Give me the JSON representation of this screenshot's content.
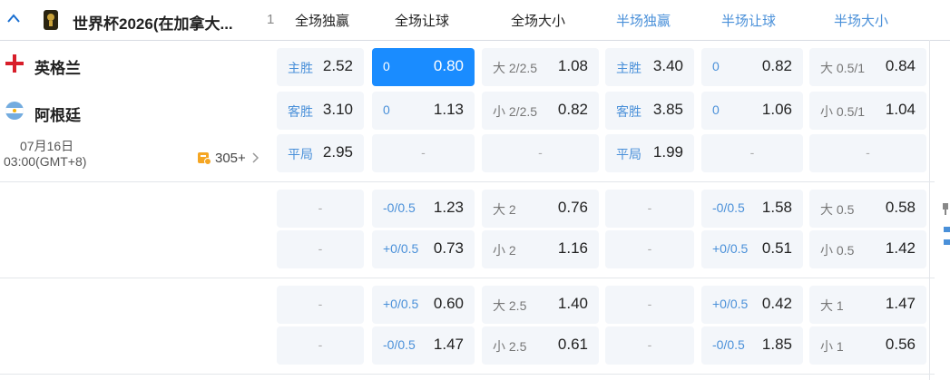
{
  "league": {
    "name": "世界杯2026(在加拿大...",
    "count": "1"
  },
  "columns": [
    "全场独赢",
    "全场让球",
    "全场大小",
    "半场独赢",
    "半场让球",
    "半场大小"
  ],
  "match": {
    "home": "英格兰",
    "away": "阿根廷",
    "date": "07月16日",
    "time": "03:00(GMT+8)",
    "more": "305+"
  },
  "rows": [
    {
      "fw": {
        "l": "主胜",
        "v": "2.52"
      },
      "fh": {
        "l": "0",
        "v": "0.80",
        "sel": true
      },
      "fo": {
        "l": "大 2/2.5",
        "v": "1.08"
      },
      "hw": {
        "l": "主胜",
        "v": "3.40"
      },
      "hh": {
        "l": "0",
        "v": "0.82"
      },
      "ho": {
        "l": "大 0.5/1",
        "v": "0.84"
      }
    },
    {
      "fw": {
        "l": "客胜",
        "v": "3.10"
      },
      "fh": {
        "l": "0",
        "v": "1.13"
      },
      "fo": {
        "l": "小 2/2.5",
        "v": "0.82"
      },
      "hw": {
        "l": "客胜",
        "v": "3.85"
      },
      "hh": {
        "l": "0",
        "v": "1.06"
      },
      "ho": {
        "l": "小 0.5/1",
        "v": "1.04"
      }
    },
    {
      "fw": {
        "l": "平局",
        "v": "2.95"
      },
      "fh": null,
      "fo": null,
      "hw": {
        "l": "平局",
        "v": "1.99"
      },
      "hh": null,
      "ho": null
    },
    {
      "fw": null,
      "fh": {
        "l": "-0/0.5",
        "v": "1.23"
      },
      "fo": {
        "l": "大 2",
        "v": "0.76"
      },
      "hw": null,
      "hh": {
        "l": "-0/0.5",
        "v": "1.58"
      },
      "ho": {
        "l": "大 0.5",
        "v": "0.58"
      }
    },
    {
      "fw": null,
      "fh": {
        "l": "+0/0.5",
        "v": "0.73"
      },
      "fo": {
        "l": "小 2",
        "v": "1.16"
      },
      "hw": null,
      "hh": {
        "l": "+0/0.5",
        "v": "0.51"
      },
      "ho": {
        "l": "小 0.5",
        "v": "1.42"
      }
    },
    {
      "fw": null,
      "fh": {
        "l": "+0/0.5",
        "v": "0.60"
      },
      "fo": {
        "l": "大 2.5",
        "v": "1.40"
      },
      "hw": null,
      "hh": {
        "l": "+0/0.5",
        "v": "0.42"
      },
      "ho": {
        "l": "大 1",
        "v": "1.47"
      }
    },
    {
      "fw": null,
      "fh": {
        "l": "-0/0.5",
        "v": "1.47"
      },
      "fo": {
        "l": "小 2.5",
        "v": "0.61"
      },
      "hw": null,
      "hh": {
        "l": "-0/0.5",
        "v": "1.85"
      },
      "ho": {
        "l": "小 1",
        "v": "0.56"
      }
    }
  ],
  "colors": {
    "accent": "#1a8cff",
    "label_blue": "#4a90d9",
    "cell_bg": "#f3f6fa"
  },
  "icons": [
    "chevron-up-icon",
    "trophy-icon",
    "england-flag-icon",
    "argentina-flag-icon",
    "coupon-icon",
    "chevron-right-icon",
    "pin-icon"
  ]
}
